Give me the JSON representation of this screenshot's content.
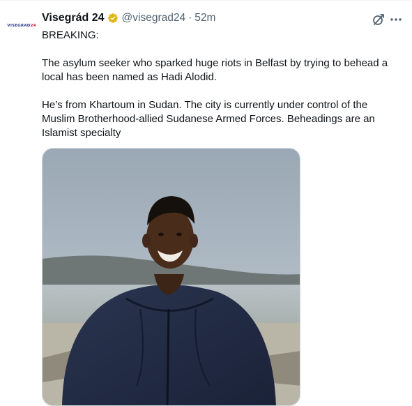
{
  "author": {
    "name": "Visegrád 24",
    "handle": "@visegrad24",
    "separator": "·",
    "time": "52m",
    "avatar_text": "VISEGRAD",
    "avatar_accent": "24"
  },
  "icons": {
    "verified": "verified-badge-icon",
    "grok": "grok-icon",
    "more": "more-icon"
  },
  "tweet": {
    "line1": "BREAKING:",
    "paragraph1": "The asylum seeker who sparked huge riots in Belfast by trying to behead a local has been named as Hadi Alodid.",
    "paragraph2": "He’s from Khartoum in Sudan. The city is currently under control of the Muslim Brotherhood-allied Sudanese Armed Forces. Beheadings are an Islamist specialty"
  },
  "colors": {
    "verified_gold": "#e2b719",
    "text": "#0f1419",
    "secondary": "#536471"
  }
}
